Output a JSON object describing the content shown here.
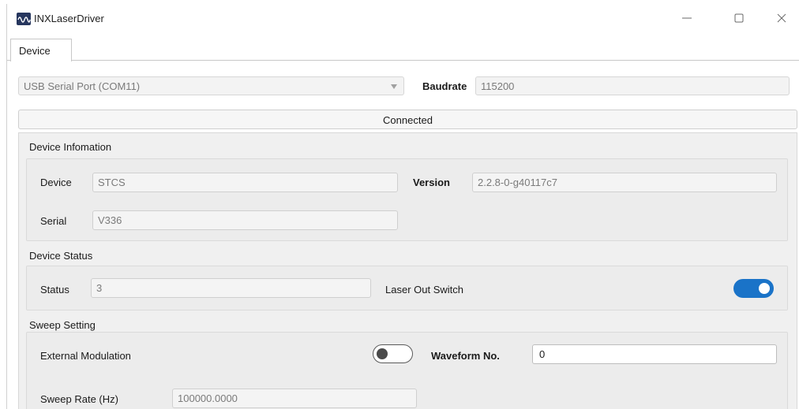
{
  "window": {
    "title": "INXLaserDriver"
  },
  "tabs": [
    {
      "label": "Device",
      "active": true
    }
  ],
  "connection": {
    "port_value": "USB Serial Port (COM11)",
    "baudrate_label": "Baudrate",
    "baudrate_value": "115200",
    "connect_button_label": "Connected"
  },
  "device_info": {
    "section_title": "Device Infomation",
    "device_label": "Device",
    "device_value": "STCS",
    "version_label": "Version",
    "version_value": "2.2.8-0-g40117c7",
    "serial_label": "Serial",
    "serial_value": "V336"
  },
  "device_status": {
    "section_title": "Device Status",
    "status_label": "Status",
    "status_value": "3",
    "laser_switch_label": "Laser Out Switch",
    "laser_switch_on": true
  },
  "sweep": {
    "section_title": "Sweep Setting",
    "ext_mod_label": "External Modulation",
    "ext_mod_on": false,
    "waveform_label": "Waveform No.",
    "waveform_value": "0",
    "rate_label": "Sweep Rate (Hz)",
    "rate_value": "100000.0000"
  },
  "colors": {
    "accent": "#1a73c8",
    "panel_bg": "#f0f0f0"
  },
  "icons": {
    "app": "app-logo-icon",
    "minimize": "minimize-icon",
    "maximize": "maximize-icon",
    "close": "close-icon",
    "dropdown": "chevron-down-icon"
  }
}
